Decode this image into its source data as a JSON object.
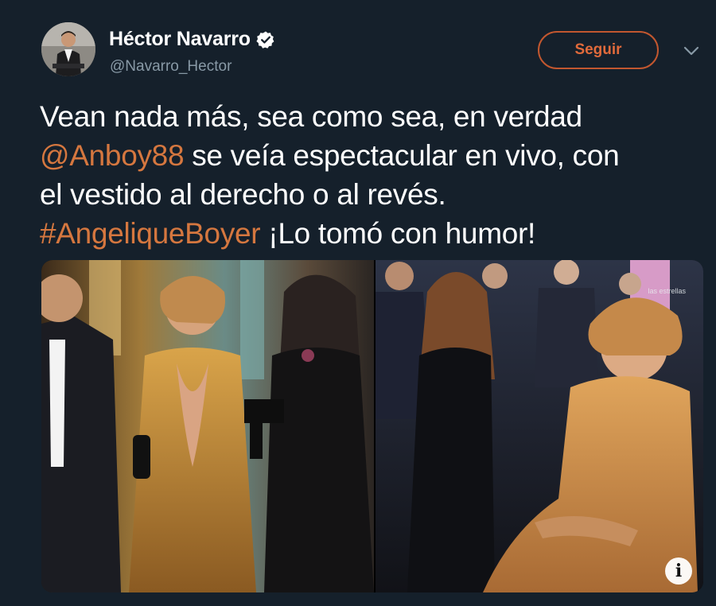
{
  "user": {
    "display_name": "Héctor Navarro",
    "handle": "@Navarro_Hector",
    "verified_icon": "verified-badge-icon",
    "avatar_icon": "profile-avatar"
  },
  "actions": {
    "follow_label": "Seguir",
    "more_icon": "chevron-down-icon"
  },
  "tweet": {
    "line1": "Vean nada más, sea como sea, en verdad",
    "mention": "@Anboy88",
    "line2_rest": " se veía espectacular en vivo, con",
    "line3": "el vestido al derecho o al revés.",
    "hashtag": "#AngeliqueBoyer",
    "line4_rest": " ¡Lo tomó con humor!"
  },
  "media": {
    "info_label": "i",
    "watermark": "las estrellas"
  },
  "colors": {
    "background": "#15202b",
    "link": "#d5773f",
    "follow_border": "#c2572f",
    "handle": "#8899a6"
  }
}
